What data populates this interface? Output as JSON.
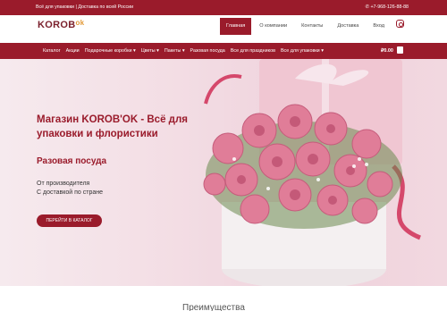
{
  "topbar": {
    "tagline": "Всё для упаковки | Доставка по всей России",
    "phone": "+7-968-126-88-88"
  },
  "header": {
    "logo_main": "KOROB",
    "logo_ok": "ok",
    "nav": [
      {
        "label": "Главная",
        "active": true
      },
      {
        "label": "О компании",
        "active": false
      },
      {
        "label": "Контакты",
        "active": false
      },
      {
        "label": "Доставка",
        "active": false
      },
      {
        "label": "Вход",
        "active": false
      }
    ]
  },
  "catnav": {
    "items": [
      "Каталог",
      "Акции",
      "Подарочные коробки ▾",
      "Цветы ▾",
      "Пакеты ▾",
      "Разовая посуда",
      "Все для праздников",
      "Все для упаковки ▾"
    ],
    "cart_total": "₽0.00"
  },
  "hero": {
    "title": "Магазин KOROB'OK - Всё для упаковки и флористики",
    "subtitle": "Разовая посуда",
    "line1": "От производителя",
    "line2": "С доставкой по стране",
    "button": "ПЕРЕЙТИ В КАТАЛОГ"
  },
  "section": {
    "title": "Преимущества"
  },
  "colors": {
    "brand": "#9a1b2b",
    "accent": "#e39b3a"
  }
}
